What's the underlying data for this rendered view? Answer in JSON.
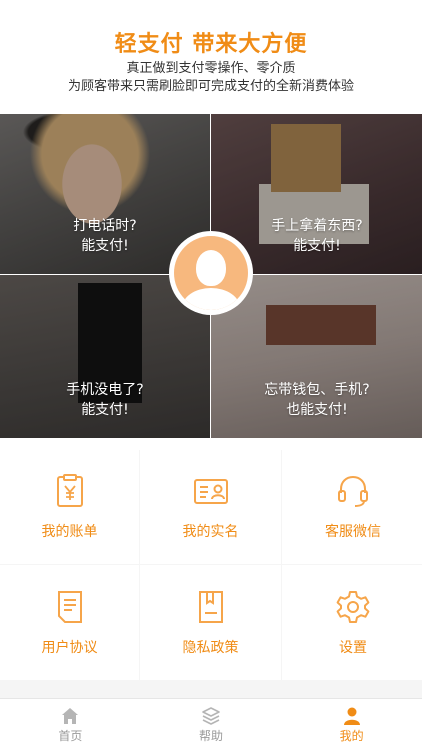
{
  "header": {
    "headline": "轻支付 带来大方便",
    "subline_1": "真正做到支付零操作、零介质",
    "subline_2": "为顾客带来只需刷脸即可完成支付的全新消费体验"
  },
  "tiles": [
    {
      "line1": "打电话时?",
      "line2": "能支付!"
    },
    {
      "line1": "手上拿着东西?",
      "line2": "能支付!"
    },
    {
      "line1": "手机没电了?",
      "line2": "能支付!"
    },
    {
      "line1": "忘带钱包、手机?",
      "line2": "也能支付!"
    }
  ],
  "menu": [
    {
      "label": "我的账单",
      "icon": "bill-icon"
    },
    {
      "label": "我的实名",
      "icon": "id-card-icon"
    },
    {
      "label": "客服微信",
      "icon": "headset-icon"
    },
    {
      "label": "用户协议",
      "icon": "document-icon"
    },
    {
      "label": "隐私政策",
      "icon": "privacy-doc-icon"
    },
    {
      "label": "设置",
      "icon": "gear-icon"
    }
  ],
  "tabbar": [
    {
      "label": "首页",
      "icon": "home-icon",
      "active": false
    },
    {
      "label": "帮助",
      "icon": "layers-icon",
      "active": false
    },
    {
      "label": "我的",
      "icon": "user-icon",
      "active": true
    }
  ],
  "colors": {
    "accent": "#f08c16",
    "inactive": "#9a9a9a",
    "avatar_bg": "#f7b87e"
  }
}
